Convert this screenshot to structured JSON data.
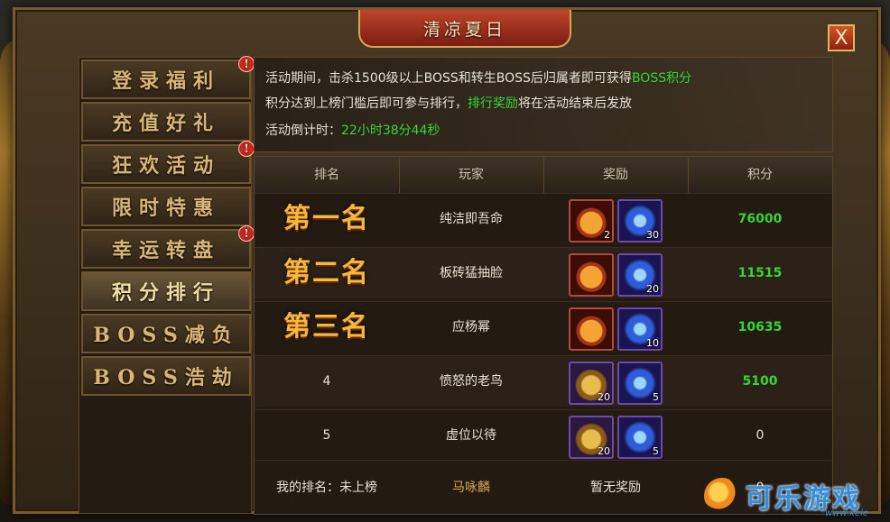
{
  "window": {
    "title": "清凉夏日",
    "close_label": "X"
  },
  "sidebar": {
    "items": [
      {
        "label": "登录福利",
        "badge": "!"
      },
      {
        "label": "充值好礼",
        "badge": ""
      },
      {
        "label": "狂欢活动",
        "badge": "!"
      },
      {
        "label": "限时特惠",
        "badge": ""
      },
      {
        "label": "幸运转盘",
        "badge": "!"
      },
      {
        "label": "积分排行",
        "badge": "",
        "active": true
      },
      {
        "label": "BOSS减负",
        "badge": ""
      },
      {
        "label": "BOSS浩劫",
        "badge": ""
      }
    ]
  },
  "info": {
    "line1_prefix": "活动期间，击杀1500级以上BOSS和转生BOSS后归属者即可获得",
    "line1_highlight": "BOSS积分",
    "line2_prefix": "积分达到上榜门槛后即可参与排行，",
    "line2_highlight": "排行奖励",
    "line2_suffix": "将在活动结束后发放",
    "countdown_label": "活动倒计时：",
    "countdown_value": "22小时38分44秒"
  },
  "table": {
    "headers": [
      "排名",
      "玩家",
      "奖励",
      "积分"
    ],
    "rows": [
      {
        "rank": "第一名",
        "player": "纯洁即吾命",
        "rewards": [
          {
            "icon": "potion-icon",
            "count": "2"
          },
          {
            "icon": "crystal-icon",
            "count": "30"
          }
        ],
        "score": "76000"
      },
      {
        "rank": "第二名",
        "player": "板砖猛抽脸",
        "rewards": [
          {
            "icon": "potion-icon",
            "count": ""
          },
          {
            "icon": "crystal-icon",
            "count": "20"
          }
        ],
        "score": "11515"
      },
      {
        "rank": "第三名",
        "player": "应杨幂",
        "rewards": [
          {
            "icon": "potion-icon",
            "count": ""
          },
          {
            "icon": "crystal-icon",
            "count": "10"
          }
        ],
        "score": "10635"
      },
      {
        "rank": "4",
        "player": "愤怒的老鸟",
        "rewards": [
          {
            "icon": "chest-icon",
            "count": "20"
          },
          {
            "icon": "crystal-icon",
            "count": "5"
          }
        ],
        "score": "5100"
      },
      {
        "rank": "5",
        "player": "虚位以待",
        "rewards": [
          {
            "icon": "chest-icon",
            "count": "20"
          },
          {
            "icon": "crystal-icon",
            "count": "5"
          }
        ],
        "score": "0"
      }
    ],
    "footer": {
      "my_rank": "我的排名：未上榜",
      "my_name": "马咏麟",
      "my_reward": "暂无奖励",
      "my_score": "0"
    }
  },
  "watermark": {
    "text": "可乐游戏",
    "sub": "www.kele"
  }
}
